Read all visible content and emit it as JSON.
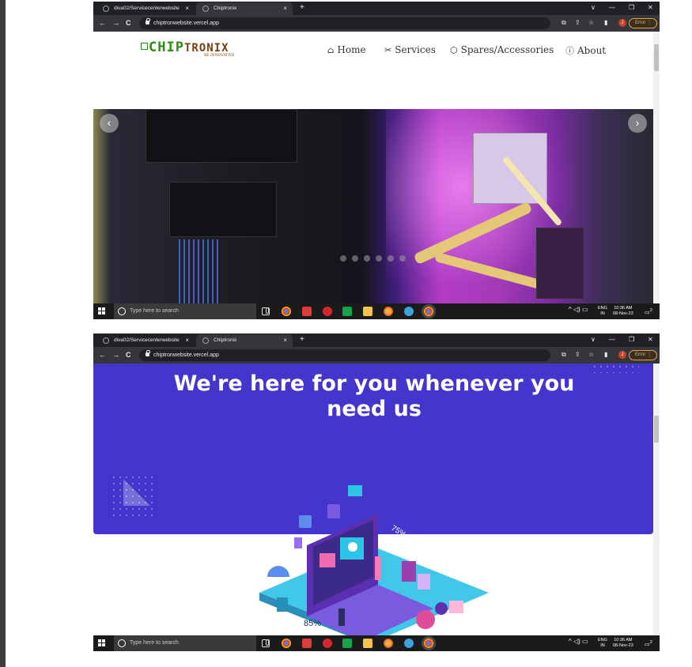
{
  "browser": {
    "tabs": [
      {
        "title": "diva02/Servicecenterwebsite",
        "active": false
      },
      {
        "title": "Chiptronix",
        "active": true
      }
    ],
    "new_tab": "+",
    "tab_close": "×",
    "window_controls": [
      "∨",
      "—",
      "❐",
      "✕"
    ],
    "nav": {
      "back": "←",
      "forward": "→",
      "reload": "C"
    },
    "url": "chiptronwebsite.vercel.app",
    "toolbar_icons": [
      "⧉",
      "⇪",
      "☆",
      "▮"
    ],
    "profile_initial": "J",
    "error_label": "Error",
    "error_menu": "⋮"
  },
  "site": {
    "logo": {
      "part1": "CHIP",
      "part2": "TRONIX",
      "tagline": "BE INNOVATIVE"
    },
    "nav": [
      {
        "icon": "⌂",
        "label": "Home"
      },
      {
        "icon": "✂",
        "label": "Services"
      },
      {
        "icon": "⬡",
        "label": "Spares/Accessories"
      },
      {
        "icon": "ⓘ",
        "label": "About"
      }
    ],
    "carousel": {
      "prev": "‹",
      "next": "›",
      "slide_count": 6,
      "active_slide": 0
    },
    "hero_title": "We're here for you whenever you need us",
    "illustration_labels": {
      "percent_a": "75%",
      "percent_b": "85%"
    }
  },
  "taskbar": {
    "search_placeholder": "Type here to search",
    "tray_lang": "ENG",
    "tray_region": "IN",
    "time": "10:36 AM",
    "date": "08-Nov-23",
    "notification_count": "2"
  },
  "colors": {
    "hero_bg": "#4436cc",
    "logo_green": "#2e8b17",
    "logo_brown": "#7a3d12",
    "chrome_dark": "#202124",
    "taskbar": "#1b1b1b"
  }
}
